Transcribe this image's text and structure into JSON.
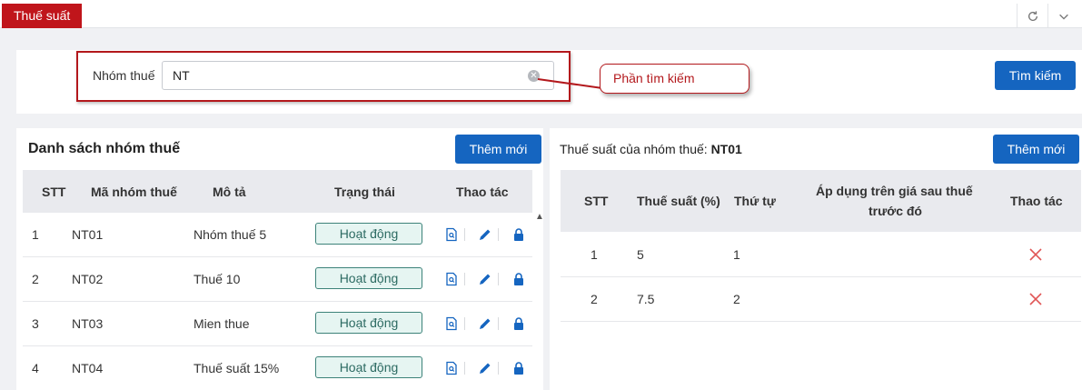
{
  "topbar": {
    "active_tab": "Thuế suất",
    "refresh_icon": "refresh-icon",
    "dropdown_icon": "chevron-down-icon"
  },
  "search": {
    "label": "Nhóm thuế",
    "value": "NT",
    "placeholder": "",
    "button": "Tìm kiếm",
    "annotation": "Phần tìm kiếm"
  },
  "left": {
    "title": "Danh sách nhóm thuế",
    "add_button": "Thêm mới",
    "headers": {
      "stt": "STT",
      "code": "Mã nhóm thuế",
      "desc": "Mô tả",
      "status": "Trạng thái",
      "actions": "Thao tác"
    },
    "rows": [
      {
        "stt": "1",
        "code": "NT01",
        "desc": "Nhóm thuế 5",
        "status": "Hoạt động"
      },
      {
        "stt": "2",
        "code": "NT02",
        "desc": "Thuế 10",
        "status": "Hoạt động"
      },
      {
        "stt": "3",
        "code": "NT03",
        "desc": "Mien thue",
        "status": "Hoạt động"
      },
      {
        "stt": "4",
        "code": "NT04",
        "desc": "Thuế suất 15%",
        "status": "Hoạt động"
      }
    ]
  },
  "right": {
    "title_prefix": "Thuế suất của nhóm thuế: ",
    "title_group": "NT01",
    "add_button": "Thêm mới",
    "headers": {
      "stt": "STT",
      "rate": "Thuế suất (%)",
      "order": "Thứ tự",
      "apply_line1": "Áp dụng trên giá sau thuế",
      "apply_line2": "trước đó",
      "actions": "Thao tác"
    },
    "rows": [
      {
        "stt": "1",
        "rate": "5",
        "order": "1"
      },
      {
        "stt": "2",
        "rate": "7.5",
        "order": "2"
      }
    ]
  },
  "colors": {
    "brand_red": "#c0151b",
    "primary_blue": "#1565c0",
    "status_green": "#3c8279",
    "delete_red": "#e05555"
  }
}
